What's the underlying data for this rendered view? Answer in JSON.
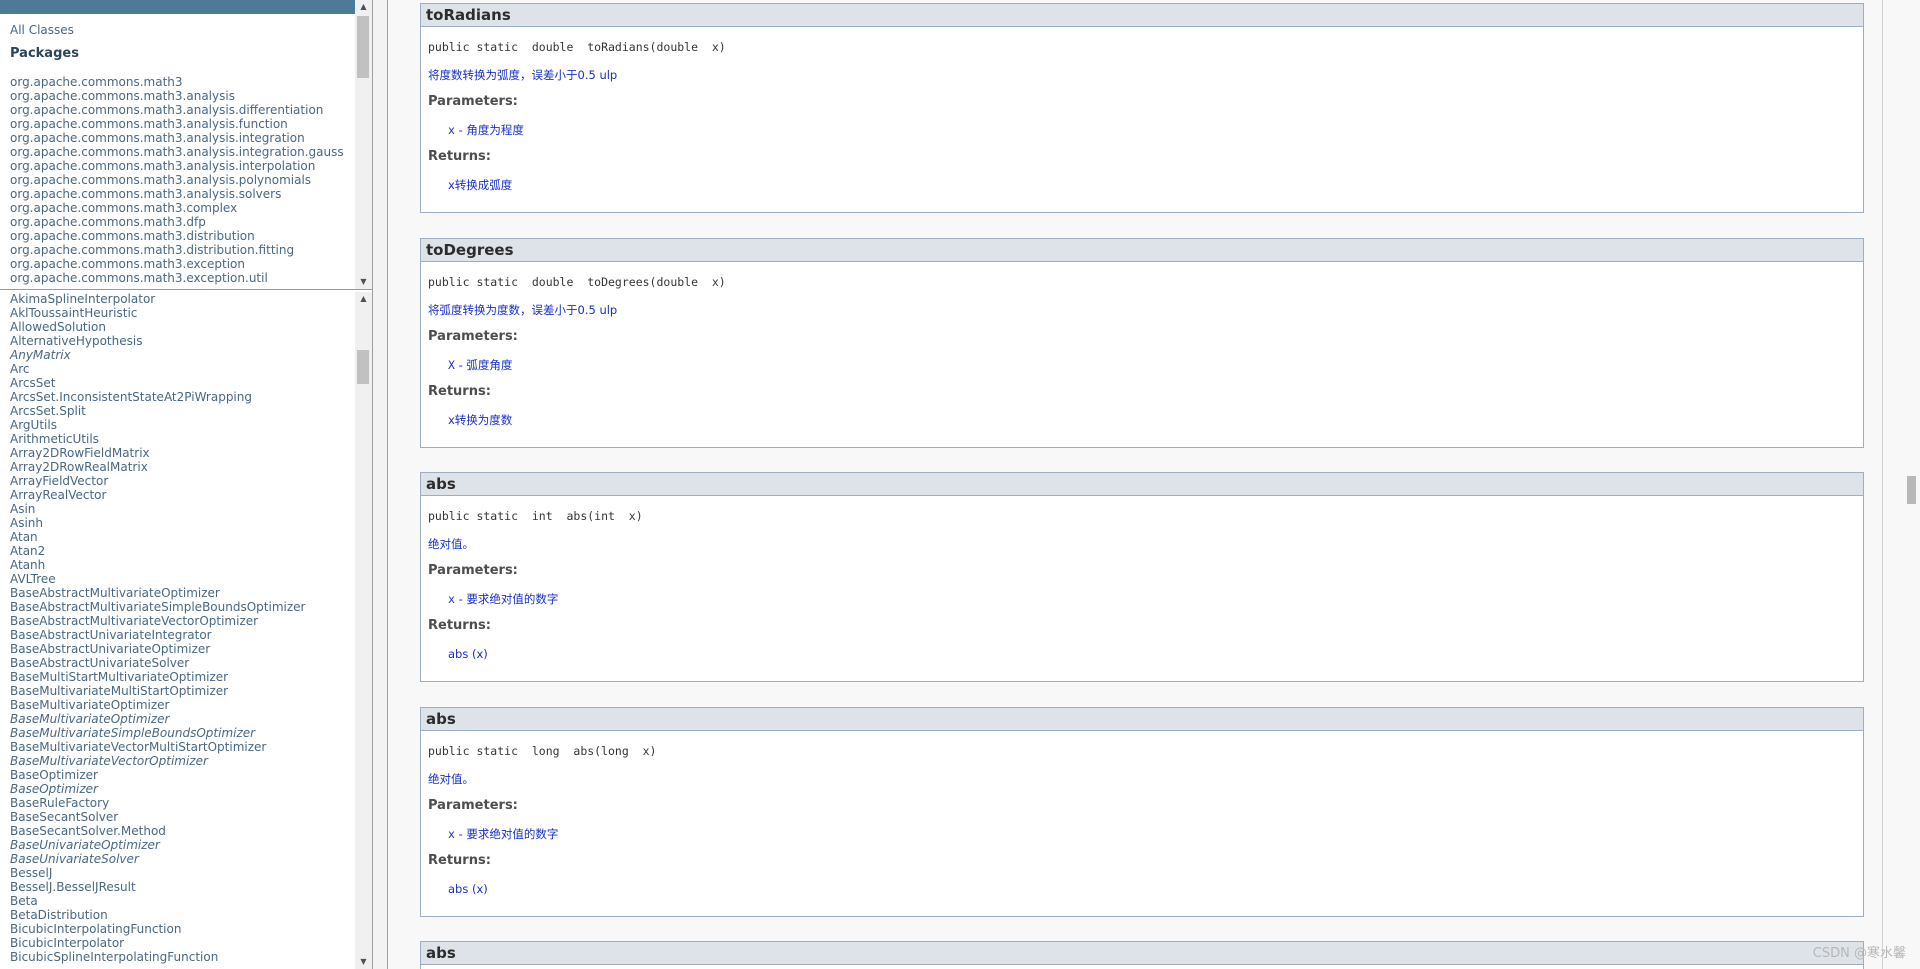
{
  "left_top": {
    "all_classes": "All Classes",
    "packages_title": "Packages",
    "packages": [
      "org.apache.commons.math3",
      "org.apache.commons.math3.analysis",
      "org.apache.commons.math3.analysis.differentiation",
      "org.apache.commons.math3.analysis.function",
      "org.apache.commons.math3.analysis.integration",
      "org.apache.commons.math3.analysis.integration.gauss",
      "org.apache.commons.math3.analysis.interpolation",
      "org.apache.commons.math3.analysis.polynomials",
      "org.apache.commons.math3.analysis.solvers",
      "org.apache.commons.math3.complex",
      "org.apache.commons.math3.dfp",
      "org.apache.commons.math3.distribution",
      "org.apache.commons.math3.distribution.fitting",
      "org.apache.commons.math3.exception",
      "org.apache.commons.math3.exception.util"
    ]
  },
  "left_bottom": {
    "classes": [
      "AkimaSplineInterpolator",
      "AklToussaintHeuristic",
      "AllowedSolution",
      "AlternativeHypothesis",
      "AnyMatrix",
      "Arc",
      "ArcsSet",
      "ArcsSet.InconsistentStateAt2PiWrapping",
      "ArcsSet.Split",
      "ArgUtils",
      "ArithmeticUtils",
      "Array2DRowFieldMatrix",
      "Array2DRowRealMatrix",
      "ArrayFieldVector",
      "ArrayRealVector",
      "Asin",
      "Asinh",
      "Atan",
      "Atan2",
      "Atanh",
      "AVLTree",
      "BaseAbstractMultivariateOptimizer",
      "BaseAbstractMultivariateSimpleBoundsOptimizer",
      "BaseAbstractMultivariateVectorOptimizer",
      "BaseAbstractUnivariateIntegrator",
      "BaseAbstractUnivariateOptimizer",
      "BaseAbstractUnivariateSolver",
      "BaseMultiStartMultivariateOptimizer",
      "BaseMultivariateMultiStartOptimizer",
      "BaseMultivariateOptimizer",
      "BaseMultivariateOptimizer",
      "BaseMultivariateSimpleBoundsOptimizer",
      "BaseMultivariateVectorMultiStartOptimizer",
      "BaseMultivariateVectorOptimizer",
      "BaseOptimizer",
      "BaseOptimizer",
      "BaseRuleFactory",
      "BaseSecantSolver",
      "BaseSecantSolver.Method",
      "BaseUnivariateOptimizer",
      "BaseUnivariateSolver",
      "BesselJ",
      "BesselJ.BesselJResult",
      "Beta",
      "BetaDistribution",
      "BicubicInterpolatingFunction",
      "BicubicInterpolator",
      "BicubicSplineInterpolatingFunction"
    ]
  },
  "methods": [
    {
      "name": "toRadians",
      "signature": "public static  double  toRadians(double  x)",
      "description": "将度数转换为弧度，误差小于0.5 ulp",
      "params_label": "Parameters:",
      "param_name": "x",
      "param_desc": " - 角度为程度",
      "returns_label": "Returns:",
      "returns": "x转换成弧度"
    },
    {
      "name": "toDegrees",
      "signature": "public static  double  toDegrees(double  x)",
      "description": "将弧度转换为度数，误差小于0.5 ulp",
      "params_label": "Parameters:",
      "param_name": "X",
      "param_desc": " - 弧度角度",
      "returns_label": "Returns:",
      "returns": "x转换为度数"
    },
    {
      "name": "abs",
      "signature": "public static  int  abs(int  x)",
      "description": "绝对值。",
      "params_label": "Parameters:",
      "param_name": "x",
      "param_desc": " - 要求绝对值的数字",
      "returns_label": "Returns:",
      "returns": "abs (x)"
    },
    {
      "name": "abs",
      "signature": "public static  long  abs(long  x)",
      "description": "绝对值。",
      "params_label": "Parameters:",
      "param_name": "x",
      "param_desc": " - 要求绝对值的数字",
      "returns_label": "Returns:",
      "returns": "abs (x)"
    },
    {
      "name": "abs"
    }
  ],
  "watermark": "CSDN @寒水馨"
}
